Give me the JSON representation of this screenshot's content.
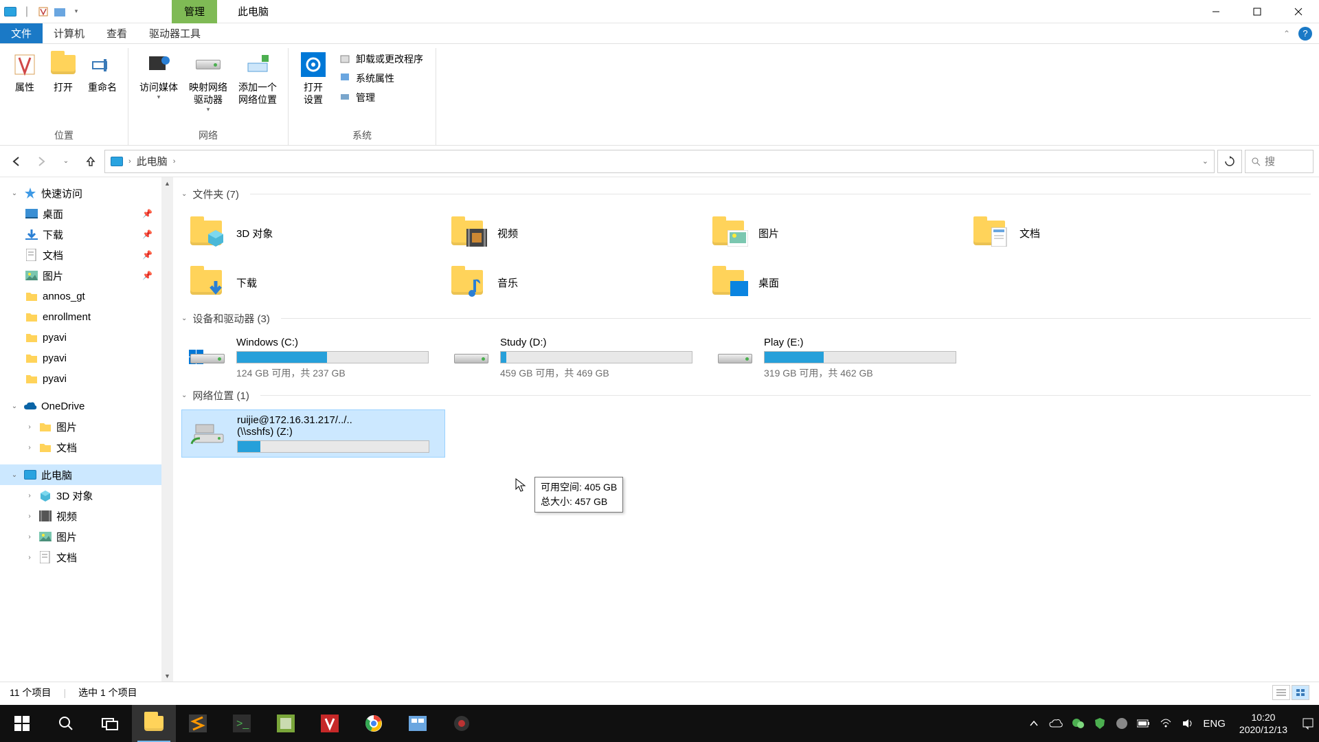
{
  "titlebar": {
    "manage_tab": "管理",
    "title": "此电脑"
  },
  "ribbon_tabs": {
    "file": "文件",
    "computer": "计算机",
    "view": "查看",
    "drive_tools": "驱动器工具"
  },
  "ribbon": {
    "properties": "属性",
    "open": "打开",
    "rename": "重命名",
    "access_media": "访问媒体",
    "map_network": "映射网络\n驱动器",
    "add_network": "添加一个\n网络位置",
    "open_settings": "打开\n设置",
    "uninstall": "卸载或更改程序",
    "system_props": "系统属性",
    "manage": "管理",
    "group_location": "位置",
    "group_network": "网络",
    "group_system": "系统"
  },
  "breadcrumb": {
    "this_pc": "此电脑"
  },
  "search": {
    "placeholder": "搜"
  },
  "sidebar": {
    "quick_access": "快速访问",
    "items_qa": [
      "桌面",
      "下载",
      "文档",
      "图片",
      "annos_gt",
      "enrollment",
      "pyavi",
      "pyavi",
      "pyavi"
    ],
    "onedrive": "OneDrive",
    "od_items": [
      "图片",
      "文档"
    ],
    "this_pc": "此电脑",
    "pc_items": [
      "3D 对象",
      "视频",
      "图片",
      "文档"
    ]
  },
  "content": {
    "section_folders": "文件夹 (7)",
    "folders": [
      "3D 对象",
      "视频",
      "图片",
      "文档",
      "下载",
      "音乐",
      "桌面"
    ],
    "section_drives": "设备和驱动器 (3)",
    "drives": [
      {
        "name": "Windows (C:)",
        "free": "124 GB 可用，共 237 GB",
        "pct": 47
      },
      {
        "name": "Study (D:)",
        "free": "459 GB 可用，共 469 GB",
        "pct": 3
      },
      {
        "name": "Play (E:)",
        "free": "319 GB 可用，共 462 GB",
        "pct": 31
      }
    ],
    "section_network": "网络位置 (1)",
    "network_drive": {
      "line1": "ruijie@172.16.31.217/../..",
      "line2": "(\\\\sshfs) (Z:)",
      "pct": 12
    },
    "tooltip": {
      "line1": "可用空间: 405 GB",
      "line2": "总大小: 457 GB"
    }
  },
  "statusbar": {
    "count": "11 个项目",
    "selected": "选中 1 个项目"
  },
  "taskbar": {
    "lang": "ENG",
    "time": "10:20",
    "date": "2020/12/13"
  }
}
